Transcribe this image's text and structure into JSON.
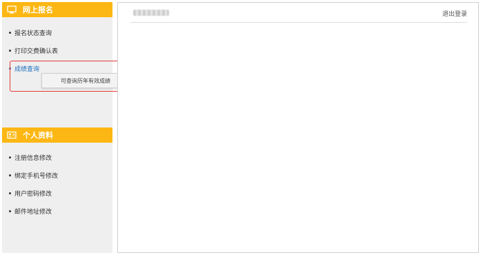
{
  "sidebar": {
    "section1": {
      "title": "网上报名",
      "icon": "monitor-icon",
      "items": [
        {
          "label": "报名状态查询"
        },
        {
          "label": "打印交费确认表"
        },
        {
          "label": "成绩查询"
        }
      ]
    },
    "tooltip": "可查询历年有效成绩",
    "section2": {
      "title": "个人资料",
      "icon": "id-card-icon",
      "items": [
        {
          "label": "注册信息修改"
        },
        {
          "label": "绑定手机号修改"
        },
        {
          "label": "用户密码修改"
        },
        {
          "label": "邮件地址修改"
        }
      ]
    }
  },
  "header": {
    "logout_label": "退出登录"
  },
  "colors": {
    "accent": "#fdb714",
    "active_link": "#1e6fbf",
    "highlight": "#e53935"
  }
}
